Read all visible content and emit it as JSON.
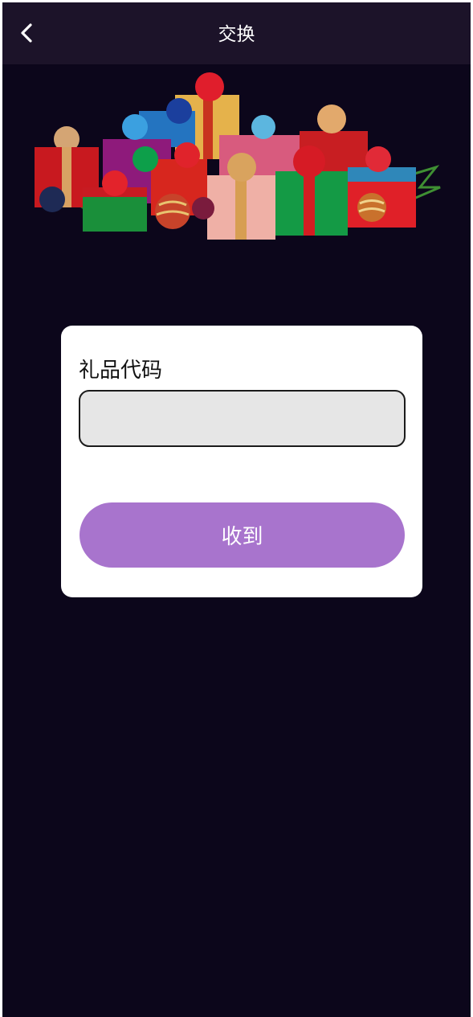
{
  "header": {
    "back_icon": "chevron-left-icon",
    "title": "交换"
  },
  "banner": {
    "image": "christmas-gifts-illustration"
  },
  "redeem_form": {
    "code_label": "礼品代码",
    "code_value": "",
    "code_placeholder": "",
    "submit_label": "收到"
  },
  "colors": {
    "background": "#0c061b",
    "header_background": "#1c1329",
    "card_background": "#ffffff",
    "input_background": "#e6e6e6",
    "button_background": "#a874cd",
    "button_text": "#ffffff"
  }
}
